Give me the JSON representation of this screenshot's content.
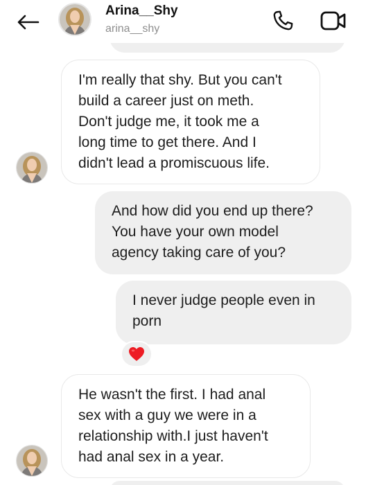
{
  "header": {
    "name": "Arina__Shy",
    "username": "arina__shy",
    "icons": {
      "back": "arrow-left-icon",
      "call": "phone-icon",
      "video": "video-camera-icon"
    }
  },
  "messages": [
    {
      "direction": "incoming",
      "text": "I'm really that shy. But you can't\nbuild a career just on meth.\nDon't judge me, it took me a\nlong time to get there. And I\ndidn't lead a promiscuous life."
    },
    {
      "direction": "outgoing",
      "text": "And how did you end up there?\nYou have your own model\nagency taking care of you?"
    },
    {
      "direction": "outgoing",
      "text": "I never judge people even in\nporn",
      "reaction": "❤️"
    },
    {
      "direction": "incoming",
      "text": "He wasn't the first. I had anal\nsex with a guy we were in a\nrelationship with.I just haven't\nhad anal sex in a year."
    }
  ],
  "colors": {
    "outgoing_bubble": "#efefef",
    "incoming_border": "#e8e8e8",
    "heart": "#ed1c24",
    "username_gray": "#8e8e8e"
  }
}
